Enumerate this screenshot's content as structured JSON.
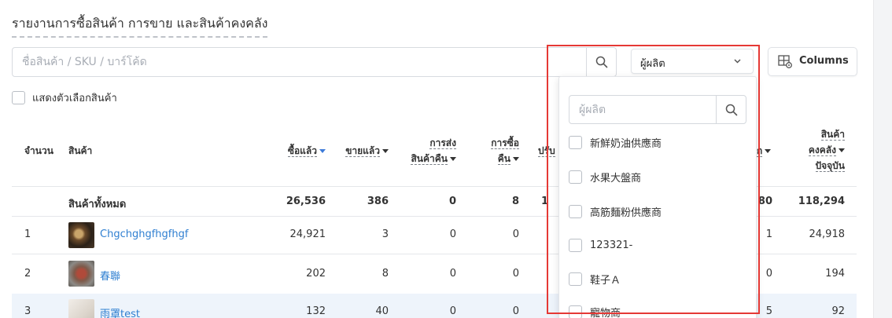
{
  "title": "รายงานการซื้อสินค้า การขาย และสินค้าคงคลัง",
  "search": {
    "placeholder": "ชื่อสินค้า / SKU / บาร์โค้ด",
    "value": ""
  },
  "vendor_filter": {
    "label": "ผู้ผลิต"
  },
  "columns_button": {
    "label": "Columns"
  },
  "show_options": {
    "label": "แสดงตัวเลือกสินค้า"
  },
  "table": {
    "headers": {
      "qty": "จำนวน",
      "product": "สินค้า",
      "bought": "ซื้อแล้ว",
      "sold": "ขายแล้ว",
      "return_l1": "การส่ง",
      "return_l2": "สินค้าคืน",
      "purch_l1": "การซื้อ",
      "purch_l2": "คืน",
      "adjust_partial": "ปรับ",
      "hidden_partial": "ก",
      "stock_l1": "สินค้า",
      "stock_l2": "คงคลัง",
      "stock_l3": "ปัจจุบัน"
    },
    "total": {
      "label": "สินค้าทั้งหมด",
      "bought": "26,536",
      "sold": "386",
      "return": "0",
      "purch": "8",
      "adjust_partial": "1",
      "hidden_partial": "80",
      "stock": "118,294"
    },
    "rows": [
      {
        "no": "1",
        "name": "Chgchghgfhgfhgf",
        "bought": "24,921",
        "sold": "3",
        "return": "0",
        "purch": "0",
        "hidden_partial": "1",
        "stock": "24,918"
      },
      {
        "no": "2",
        "name": "春聯",
        "bought": "202",
        "sold": "8",
        "return": "0",
        "purch": "0",
        "hidden_partial": "0",
        "stock": "194"
      },
      {
        "no": "3",
        "name": "雨罩test",
        "bought": "132",
        "sold": "40",
        "return": "0",
        "purch": "0",
        "hidden_partial": "5",
        "stock": "92"
      }
    ]
  },
  "dropdown": {
    "search_placeholder": "ผู้ผลิต",
    "items": [
      {
        "label": "新鮮奶油供應商"
      },
      {
        "label": "水果大盤商"
      },
      {
        "label": "高筋麵粉供應商"
      },
      {
        "label": "123321-"
      },
      {
        "label": "鞋子Ａ"
      },
      {
        "label": "寵物商"
      }
    ]
  },
  "colors": {
    "link": "#2f7fd1",
    "highlight_box": "#e53935",
    "row_highlight": "#eef4fb",
    "sort_caret": "#3d7bd9"
  },
  "icons": [
    "search-icon",
    "chevron-down-icon",
    "columns-gear-icon"
  ]
}
